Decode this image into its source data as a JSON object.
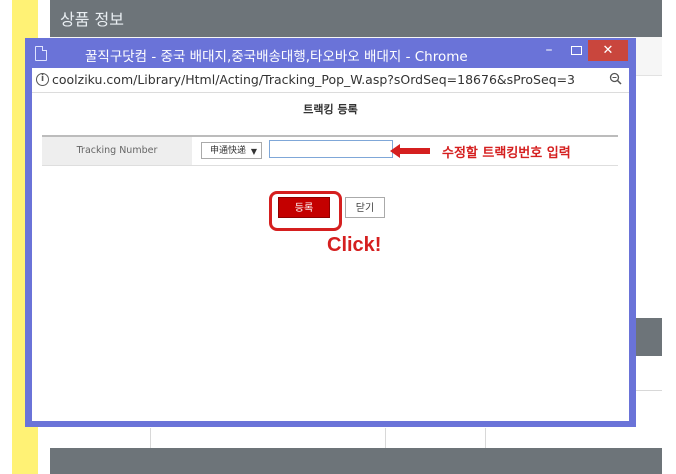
{
  "background": {
    "section_title": "상품 정보"
  },
  "window": {
    "title": "꿀직구닷컴 - 중국 배대지,중국배송대행,타오바오 배대지 - Chrome",
    "controls": {
      "minimize": "–",
      "close": "✕"
    },
    "address_url": "coolziku.com/Library/Html/Acting/Tracking_Pop_W.asp?sOrdSeq=18676&sProSeq=3"
  },
  "popup": {
    "title": "트랙킹 등록",
    "form": {
      "label": "Tracking Number",
      "carrier_selected": "申通快递",
      "tracking_value": ""
    },
    "buttons": {
      "register": "등록",
      "close": "닫기"
    }
  },
  "annotations": {
    "arrow_note": "수정할 트랙킹번호 입력",
    "click": "Click!",
    "color": "#d51f1f"
  }
}
